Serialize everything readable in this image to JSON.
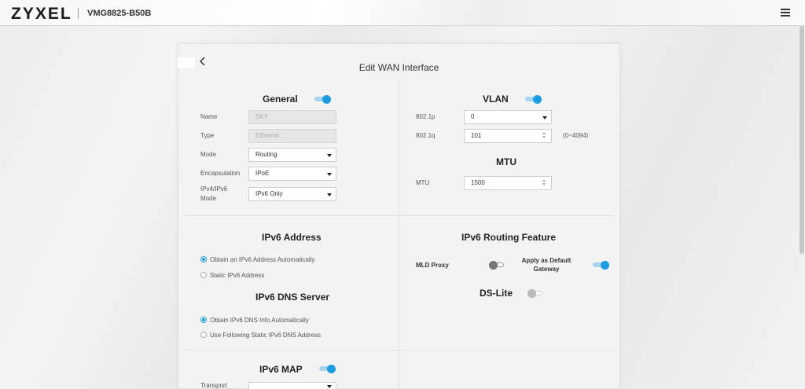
{
  "header": {
    "logo": "ZYXEL",
    "model": "VMG8825-B50B"
  },
  "page": {
    "title": "Edit WAN Interface"
  },
  "general": {
    "title": "General",
    "enabled": true,
    "name_label": "Name",
    "name_value": "SKY",
    "type_label": "Type",
    "type_value": "Ethernet",
    "mode_label": "Mode",
    "mode_value": "Routing",
    "encapsulation_label": "Encapsulation",
    "encapsulation_value": "IPoE",
    "ipmode_label_1": "IPv4/IPv6",
    "ipmode_label_2": "Mode",
    "ipmode_value": "IPv6 Only"
  },
  "vlan": {
    "title": "VLAN",
    "enabled": true,
    "p_label": "802.1p",
    "p_value": "0",
    "q_label": "802.1q",
    "q_value": "101",
    "q_range": "(0~4094)"
  },
  "mtu": {
    "title": "MTU",
    "label": "MTU",
    "value": "1500"
  },
  "ipv6_address": {
    "title": "IPv6 Address",
    "option_auto": "Obtain an IPv6 Address Automatically",
    "option_static": "Static IPv6 Address",
    "selected": "auto"
  },
  "ipv6_dns": {
    "title": "IPv6 DNS Server",
    "option_auto": "Obtain IPv6 DNS Info Automatically",
    "option_static": "Use Following Static IPv6 DNS Address",
    "selected": "auto"
  },
  "ipv6_routing": {
    "title": "IPv6 Routing Feature",
    "mld_label": "MLD Proxy",
    "mld_enabled": false,
    "gateway_label_1": "Apply as Default",
    "gateway_label_2": "Gateway",
    "gateway_enabled": true,
    "dslite_label": "DS-Lite",
    "dslite_enabled": false
  },
  "ipv6_map": {
    "title": "IPv6 MAP",
    "enabled": true,
    "transport_label": "Transport"
  }
}
